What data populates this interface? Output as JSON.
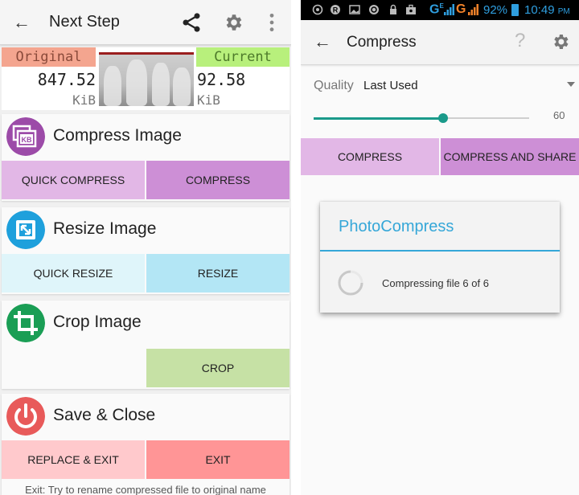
{
  "left_screen": {
    "appbar": {
      "back_icon": "arrow-left-icon",
      "title": "Next Step",
      "actions": [
        "share-icon",
        "gear-icon",
        "more-vert-icon"
      ]
    },
    "sizes": {
      "original_label": "Original",
      "original_value": "847.52",
      "original_unit": "KiB",
      "current_label": "Current",
      "current_value": "92.58",
      "current_unit": "KiB"
    },
    "cards": {
      "compress": {
        "icon": "compress-kb-icon",
        "title": "Compress Image",
        "buttons": [
          "QUICK COMPRESS",
          "COMPRESS"
        ]
      },
      "resize": {
        "icon": "resize-icon",
        "title": "Resize Image",
        "buttons": [
          "QUICK RESIZE",
          "RESIZE"
        ]
      },
      "crop": {
        "icon": "crop-icon",
        "title": "Crop Image",
        "buttons": [
          "CROP"
        ]
      },
      "save": {
        "icon": "power-icon",
        "title": "Save & Close",
        "buttons": [
          "REPLACE & EXIT",
          "EXIT"
        ],
        "hint": "Exit: Try to rename compressed file to original name"
      }
    },
    "colors": {
      "original_label_bg": "#f4a58f",
      "current_label_bg": "#b8f07c",
      "compress_icon": "#9c4ba8",
      "compress_btn_light": "#e2b7e6",
      "compress_btn_dark": "#cd8fd6",
      "resize_icon": "#1ea0dc",
      "resize_btn_light": "#dff5fa",
      "resize_btn_dark": "#b3e6f5",
      "crop_icon": "#1a9e55",
      "crop_btn": "#c6e1a5",
      "save_icon": "#e85a5a",
      "save_btn_light": "#ffc9cc",
      "save_btn_dark": "#ff9596"
    }
  },
  "right_screen": {
    "status_bar": {
      "notification_icons": [
        "whatsapp-icon",
        "app-icon",
        "image-icon",
        "sync-icon",
        "lock-icon",
        "briefcase-icon"
      ],
      "network1": "G",
      "network1_sub": "E",
      "network2": "G",
      "battery_percent": "92%",
      "time": "10:49",
      "ampm": "PM"
    },
    "appbar": {
      "back_icon": "arrow-left-icon",
      "title": "Compress",
      "actions": [
        "help-icon",
        "gear-icon"
      ]
    },
    "quality": {
      "label": "Quality",
      "selected": "Last Used",
      "slider_value": 60,
      "slider_max": 100,
      "slider_value_text": "60"
    },
    "buttons": [
      "COMPRESS",
      "COMPRESS AND SHARE"
    ],
    "dialog": {
      "title": "PhotoCompress",
      "message": "Compressing file 6 of 6"
    },
    "colors": {
      "accent": "#1a9a8a",
      "dialog_title": "#35a7d8"
    }
  }
}
